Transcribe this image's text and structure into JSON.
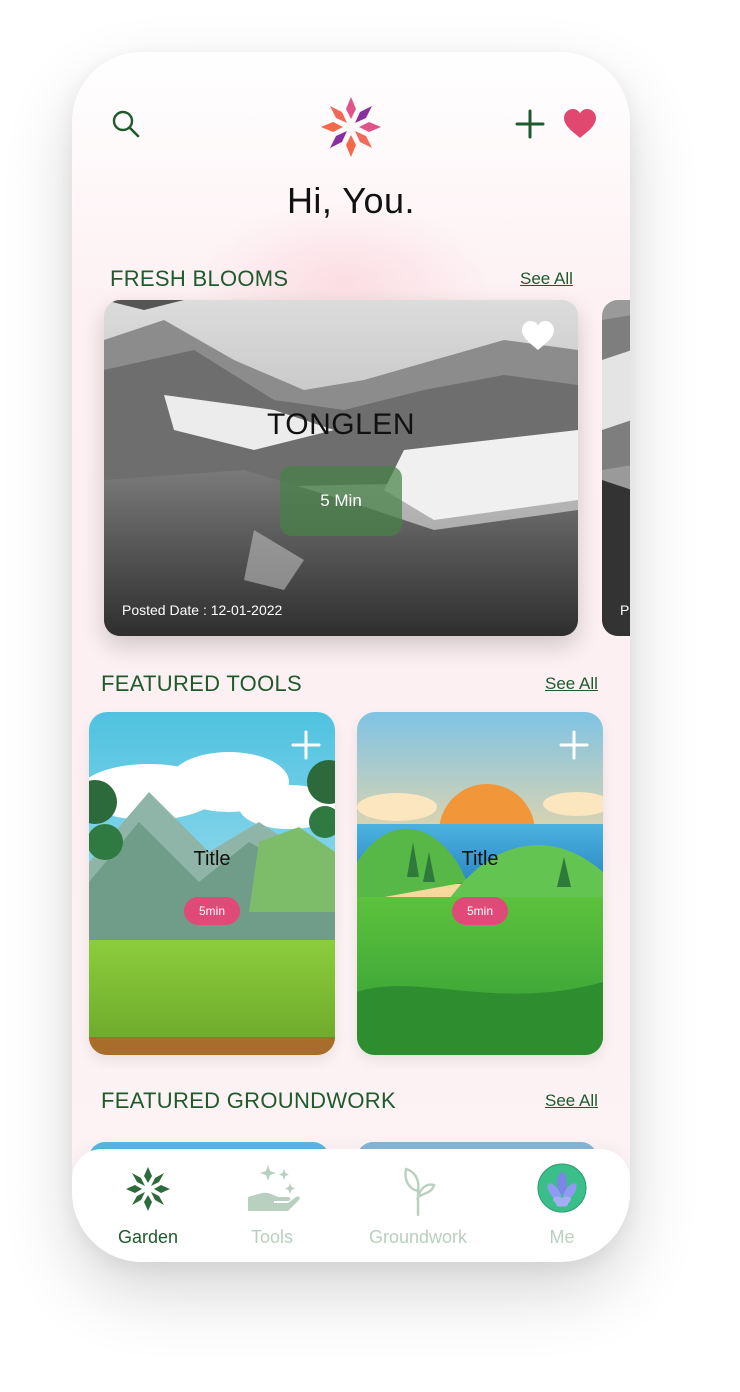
{
  "header": {
    "search_icon": "search-icon",
    "logo": "flower-logo",
    "add_icon": "plus-icon",
    "favorite_icon": "heart-icon"
  },
  "greeting": "Hi, You.",
  "fresh_blooms": {
    "title": "FRESH BLOOMS",
    "see_all": "See All",
    "card": {
      "title": "TONGLEN",
      "duration": "5 Min",
      "posted_date": "Posted Date : 12-01-2022"
    },
    "peek_label": "P"
  },
  "featured_tools": {
    "title": "FEATURED TOOLS",
    "see_all": "See All",
    "cards": [
      {
        "title": "Title",
        "duration": "5min"
      },
      {
        "title": "Title",
        "duration": "5min"
      }
    ]
  },
  "featured_groundwork": {
    "title": "FEATURED GROUNDWORK",
    "see_all": "See All"
  },
  "nav": {
    "items": [
      {
        "label": "Garden",
        "icon": "garden-icon",
        "active": true
      },
      {
        "label": "Tools",
        "icon": "hand-sparkles-icon",
        "active": false
      },
      {
        "label": "Groundwork",
        "icon": "sprout-icon",
        "active": false
      },
      {
        "label": "Me",
        "icon": "avatar-lotus-icon",
        "active": false
      }
    ]
  },
  "colors": {
    "brand_green": "#1f5a2c",
    "accent_pink": "#e04a78",
    "inactive_nav": "#b9cfc0"
  }
}
